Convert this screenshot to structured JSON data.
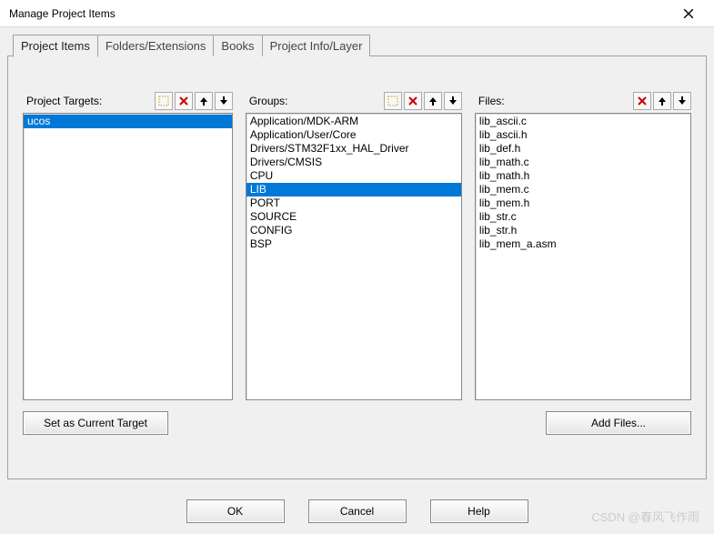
{
  "window": {
    "title": "Manage Project Items"
  },
  "tabs": {
    "items": [
      {
        "label": "Project Items",
        "active": true
      },
      {
        "label": "Folders/Extensions"
      },
      {
        "label": "Books"
      },
      {
        "label": "Project Info/Layer"
      }
    ]
  },
  "columns": {
    "targets": {
      "label": "Project Targets:",
      "items": [
        "ucos"
      ],
      "selectedIndex": 0,
      "button": "Set as Current Target"
    },
    "groups": {
      "label": "Groups:",
      "items": [
        "Application/MDK-ARM",
        "Application/User/Core",
        "Drivers/STM32F1xx_HAL_Driver",
        "Drivers/CMSIS",
        "CPU",
        "LIB",
        "PORT",
        "SOURCE",
        "CONFIG",
        "BSP"
      ],
      "selectedIndex": 5
    },
    "files": {
      "label": "Files:",
      "items": [
        "lib_ascii.c",
        "lib_ascii.h",
        "lib_def.h",
        "lib_math.c",
        "lib_math.h",
        "lib_mem.c",
        "lib_mem.h",
        "lib_str.c",
        "lib_str.h",
        "lib_mem_a.asm"
      ],
      "button": "Add Files..."
    }
  },
  "footer": {
    "ok": "OK",
    "cancel": "Cancel",
    "help": "Help"
  },
  "icons": {
    "new": "new-icon",
    "delete": "delete-icon",
    "up": "arrow-up-icon",
    "down": "arrow-down-icon",
    "close": "close-icon"
  },
  "watermark": "CSDN @春风飞作雨"
}
